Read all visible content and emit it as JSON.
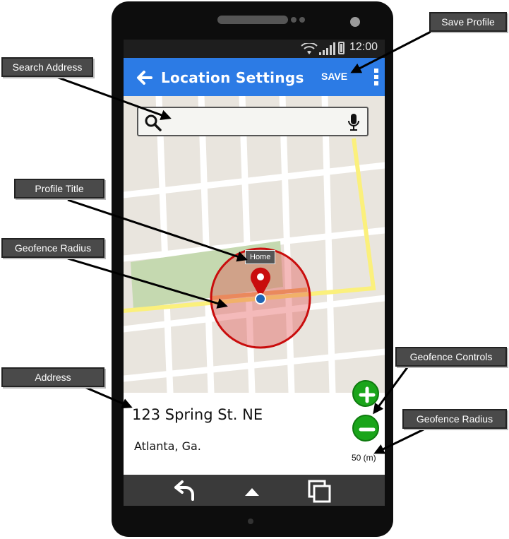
{
  "status_bar": {
    "time": "12:00"
  },
  "app_bar": {
    "title": "Location Settings",
    "save_label": "SAVE"
  },
  "search": {
    "value": "",
    "placeholder": ""
  },
  "map": {
    "pin_label": "Home"
  },
  "address": {
    "line1": "123 Spring St. NE",
    "line2": "Atlanta, Ga."
  },
  "geofence": {
    "radius_text": "50 (m)"
  },
  "annotations": {
    "save_profile": "Save Profile",
    "search_address": "Search Address",
    "profile_title": "Profile Title",
    "geofence_radius": "Geofence Radius",
    "address": "Address",
    "geofence_controls": "Geofence Controls",
    "geofence_radius_2": "Geofence Radius"
  },
  "colors": {
    "app_bar": "#2c7be5",
    "fab": "#1aa51a",
    "geofence_fill": "#e89b9b",
    "geofence_stroke": "#cc0000",
    "road_highlight": "#fff27a"
  },
  "icons": {
    "back": "arrow-left-icon",
    "more": "more-vertical-icon",
    "search": "search-icon",
    "mic": "mic-icon",
    "pin": "map-pin-icon",
    "zoom_in": "plus-icon",
    "zoom_out": "minus-icon",
    "nav_back": "nav-back-icon",
    "nav_home": "nav-home-icon",
    "nav_recents": "nav-recents-icon"
  }
}
